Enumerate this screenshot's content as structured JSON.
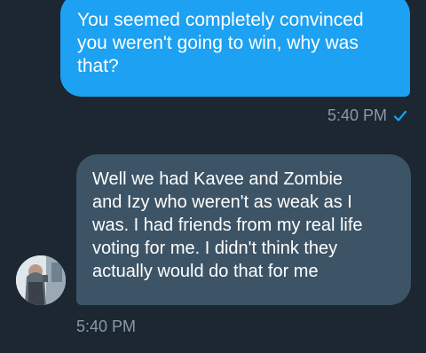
{
  "messages": {
    "sent": {
      "text": "You seemed completely convinced\nyou weren't going to win, why was\nthat?",
      "time": "5:40 PM",
      "status_icon": "read-check-icon"
    },
    "received": {
      "text": "Well we had Kavee and Zombie\nand Izy who weren't as weak as I\nwas. I had friends from my real life\nvoting for me. I didn't think they\nactually would do that for me",
      "time": "5:40 PM",
      "avatar_icon": "avatar-photo"
    }
  },
  "colors": {
    "background": "#1c2732",
    "sent_bubble": "#1da1f2",
    "received_bubble": "#3d5466",
    "meta_text": "#8899a6",
    "check": "#1da1f2"
  }
}
